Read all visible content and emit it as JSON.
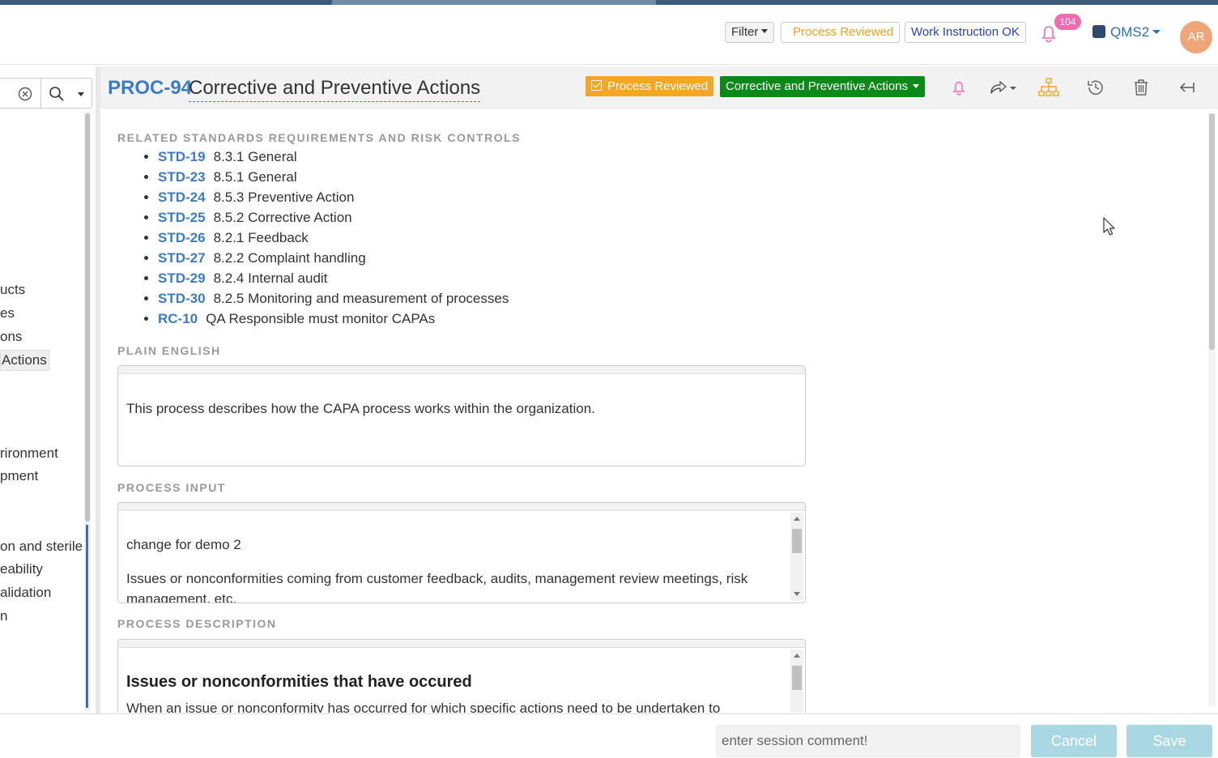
{
  "header": {
    "filter_label": "Filter",
    "process_reviewed_label": "Process Reviewed",
    "work_instruction_label": "Work Instruction OK",
    "notifications_count": "104",
    "workspace_label": "QMS2",
    "user_initials": "AR"
  },
  "sidebar": {
    "items": [
      {
        "label": "ucts"
      },
      {
        "label": "es"
      },
      {
        "label": "ons"
      },
      {
        "label": "Actions"
      },
      {
        "label": "rironment"
      },
      {
        "label": "pment"
      },
      {
        "label": "on and sterile"
      },
      {
        "label": "eability"
      },
      {
        "label": "alidation"
      },
      {
        "label": "n"
      }
    ]
  },
  "titlebar": {
    "proc_id": "PROC-94",
    "proc_title": "Corrective and Preventive Actions",
    "status_tag": "Process Reviewed",
    "type_dropdown": "Corrective and Preventive Actions"
  },
  "sections": {
    "related_heading": "RELATED STANDARDS REQUIREMENTS AND RISK CONTROLS",
    "related": [
      {
        "code": "STD-19",
        "text": "8.3.1 General"
      },
      {
        "code": "STD-23",
        "text": "8.5.1 General"
      },
      {
        "code": "STD-24",
        "text": "8.5.3 Preventive Action"
      },
      {
        "code": "STD-25",
        "text": "8.5.2 Corrective Action"
      },
      {
        "code": "STD-26",
        "text": "8.2.1 Feedback"
      },
      {
        "code": "STD-27",
        "text": "8.2.2 Complaint handling"
      },
      {
        "code": "STD-29",
        "text": "8.2.4 Internal audit"
      },
      {
        "code": "STD-30",
        "text": "8.2.5 Monitoring and measurement of processes"
      },
      {
        "code": "RC-10",
        "text": "QA Responsible must monitor CAPAs"
      }
    ],
    "plain_english_heading": "PLAIN ENGLISH",
    "plain_english_text": "This process describes how the CAPA process works within the organization.",
    "process_input_heading": "PROCESS INPUT",
    "process_input_line1": "change for demo 2",
    "process_input_line2": "Issues or nonconformities coming from customer feedback, audits, management review meetings, risk management, etc.",
    "process_description_heading": "PROCESS DESCRIPTION",
    "process_description_title": "Issues or nonconformities that have occured",
    "process_description_cut": "When an issue or nonconformity has occurred for which specific actions need to be undertaken to"
  },
  "footer": {
    "session_placeholder": "enter session comment!",
    "cancel_label": "Cancel",
    "save_label": "Save"
  },
  "colors": {
    "accent_blue": "#3d7cc0",
    "reviewed_orange": "#f5a623",
    "cpa_green": "#0b8a1a",
    "badge_pink": "#f06bb0",
    "footer_button": "#a9d8e2"
  }
}
